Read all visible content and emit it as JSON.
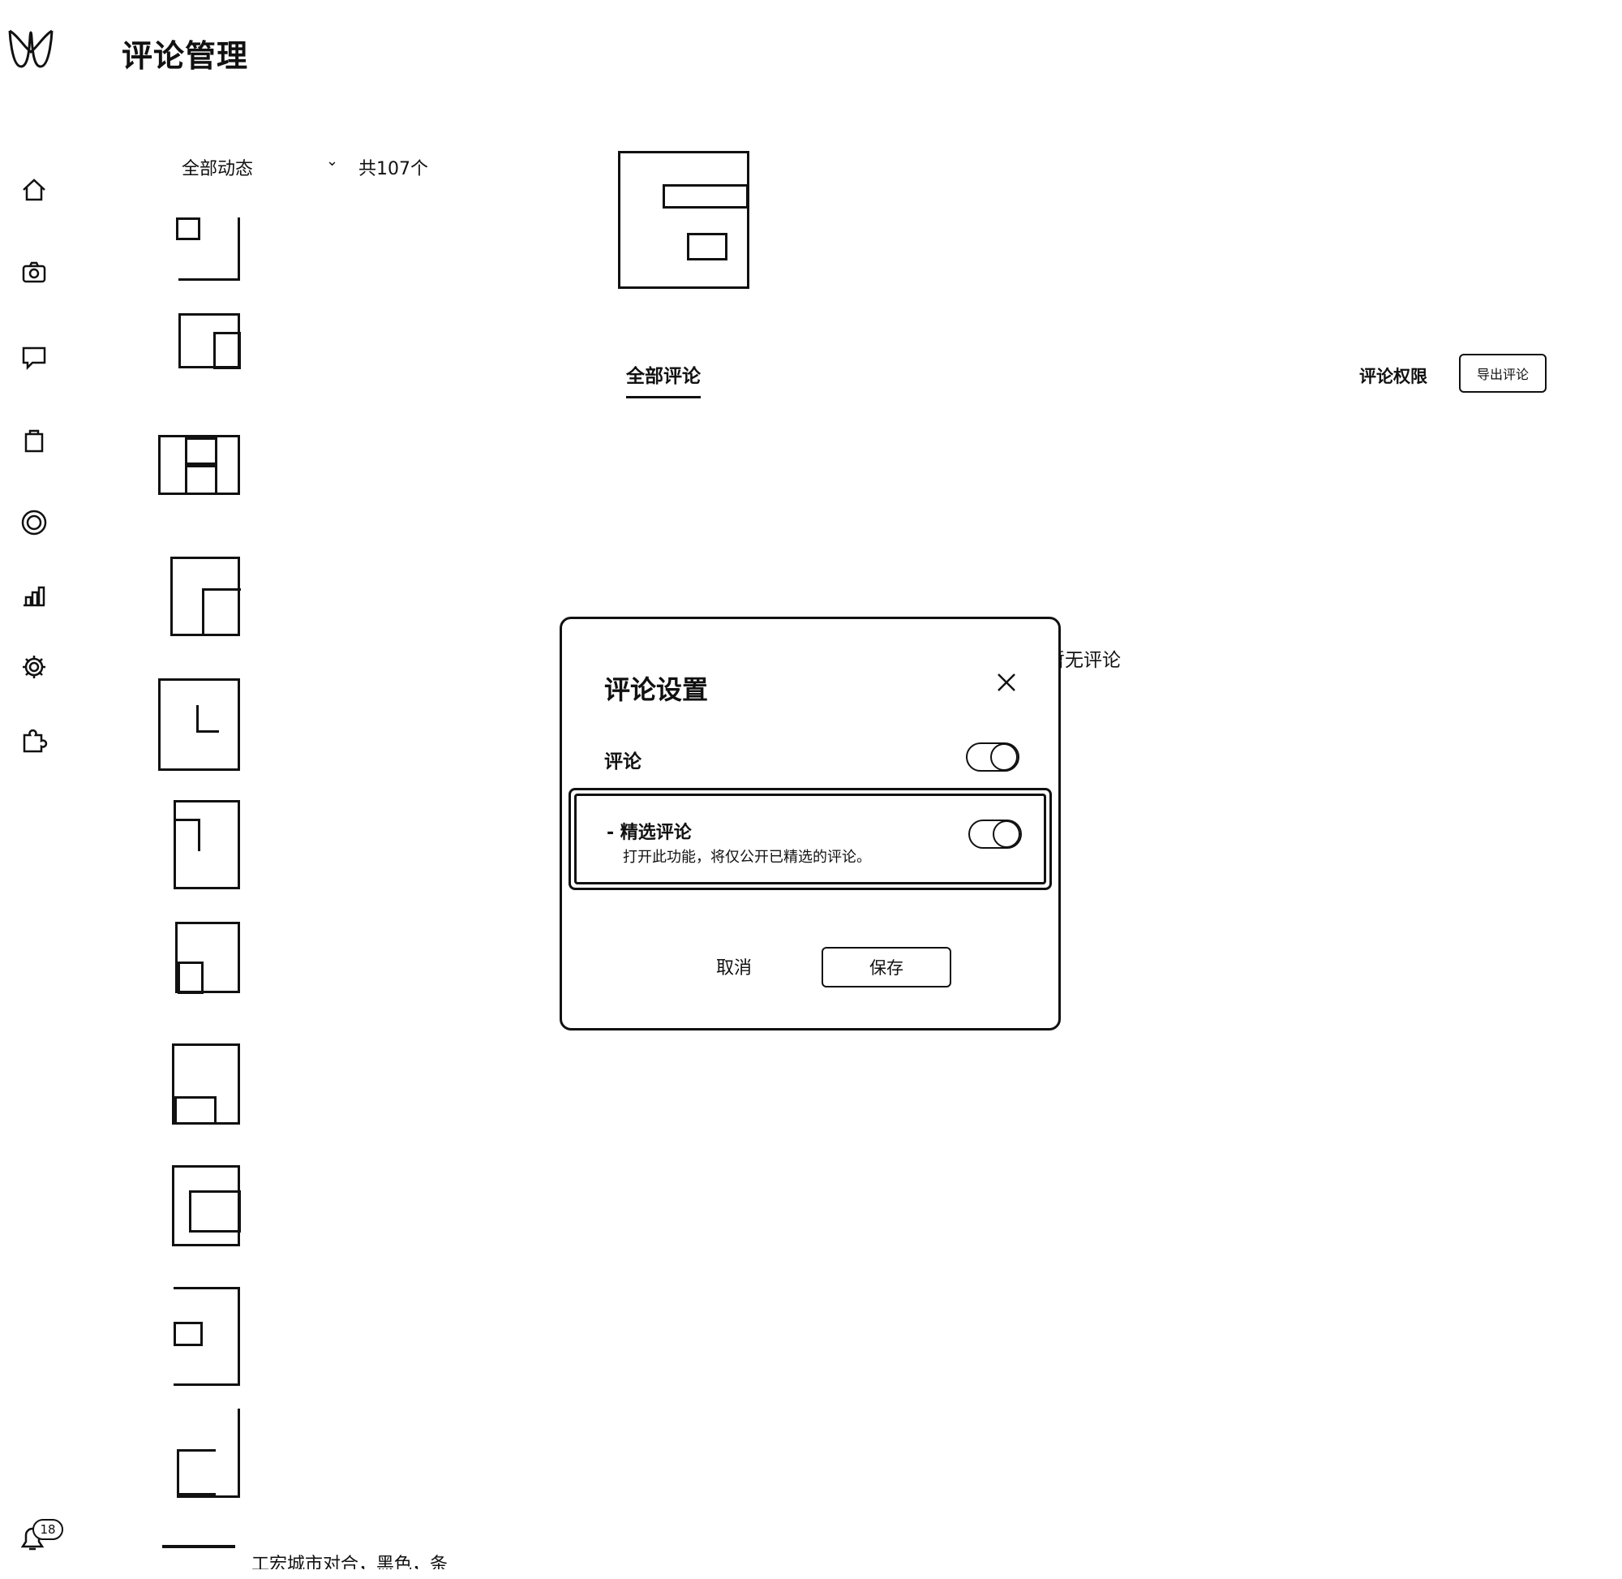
{
  "header": {
    "title": "评论管理",
    "logo_icon": "infinity-logo-icon"
  },
  "sidebar": {
    "items": [
      {
        "icon": "home-icon"
      },
      {
        "icon": "camera-icon"
      },
      {
        "icon": "message-icon"
      },
      {
        "icon": "shopping-bag-icon"
      },
      {
        "icon": "target-icon"
      },
      {
        "icon": "chart-icon"
      },
      {
        "icon": "gear-icon"
      },
      {
        "icon": "puzzle-icon"
      }
    ],
    "notifications": {
      "icon": "bell-icon",
      "count": "18"
    }
  },
  "feed": {
    "filter_label": "全部动态",
    "count_text": "共107个",
    "bottom_item_text": "工宏城市对合，黑色，条"
  },
  "main": {
    "tab_all": "全部评论",
    "permission_label": "评论权限",
    "export_button": "导出评论",
    "empty_text": "暂无评论"
  },
  "modal": {
    "title": "评论设置",
    "comment_label": "评论",
    "comment_toggle_on": true,
    "featured_title": "- 精选评论",
    "featured_desc": "打开此功能，将仅公开已精选的评论。",
    "featured_toggle_on": true,
    "cancel": "取消",
    "save": "保存"
  }
}
